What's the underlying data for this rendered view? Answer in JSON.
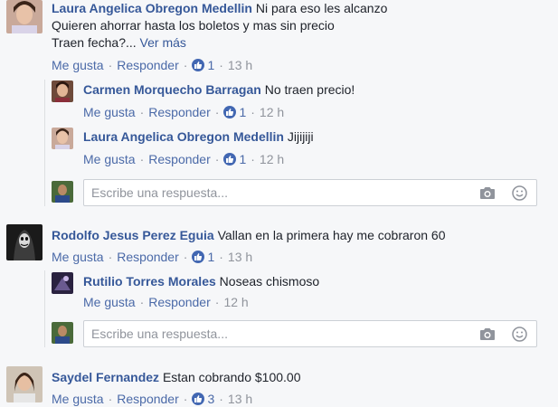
{
  "comments": [
    {
      "author": "Laura Angelica Obregon Medellin",
      "text_line1": "Ni para eso les alcanzo",
      "text_line2": "Quieren ahorrar hasta los boletos y mas sin precio",
      "text_line3": "Traen fecha?...",
      "see_more": "Ver más",
      "like_label": "Me gusta",
      "reply_label": "Responder",
      "like_count": "1",
      "time": "13 h",
      "replies": [
        {
          "author": "Carmen Morquecho Barragan",
          "text": "No traen precio!",
          "like_label": "Me gusta",
          "reply_label": "Responder",
          "like_count": "1",
          "time": "12 h"
        },
        {
          "author": "Laura Angelica Obregon Medellin",
          "text": "Jijijiji",
          "like_label": "Me gusta",
          "reply_label": "Responder",
          "like_count": "1",
          "time": "12 h"
        }
      ],
      "reply_placeholder": "Escribe una respuesta..."
    },
    {
      "author": "Rodolfo Jesus Perez Eguia",
      "text": "Vallan en la primera hay me cobraron 60",
      "like_label": "Me gusta",
      "reply_label": "Responder",
      "like_count": "1",
      "time": "13 h",
      "replies": [
        {
          "author": "Rutilio Torres Morales",
          "text": "Noseas chismoso",
          "like_label": "Me gusta",
          "reply_label": "Responder",
          "time": "12 h"
        }
      ],
      "reply_placeholder": "Escribe una respuesta..."
    },
    {
      "author": "Saydel Fernandez",
      "text": "Estan cobrando $100.00",
      "like_label": "Me gusta",
      "reply_label": "Responder",
      "like_count": "3",
      "time": "13 h"
    }
  ],
  "colors": {
    "name": "#365899",
    "link": "#4b6aa8",
    "muted": "#90949c",
    "like_badge": "#4267b2"
  }
}
